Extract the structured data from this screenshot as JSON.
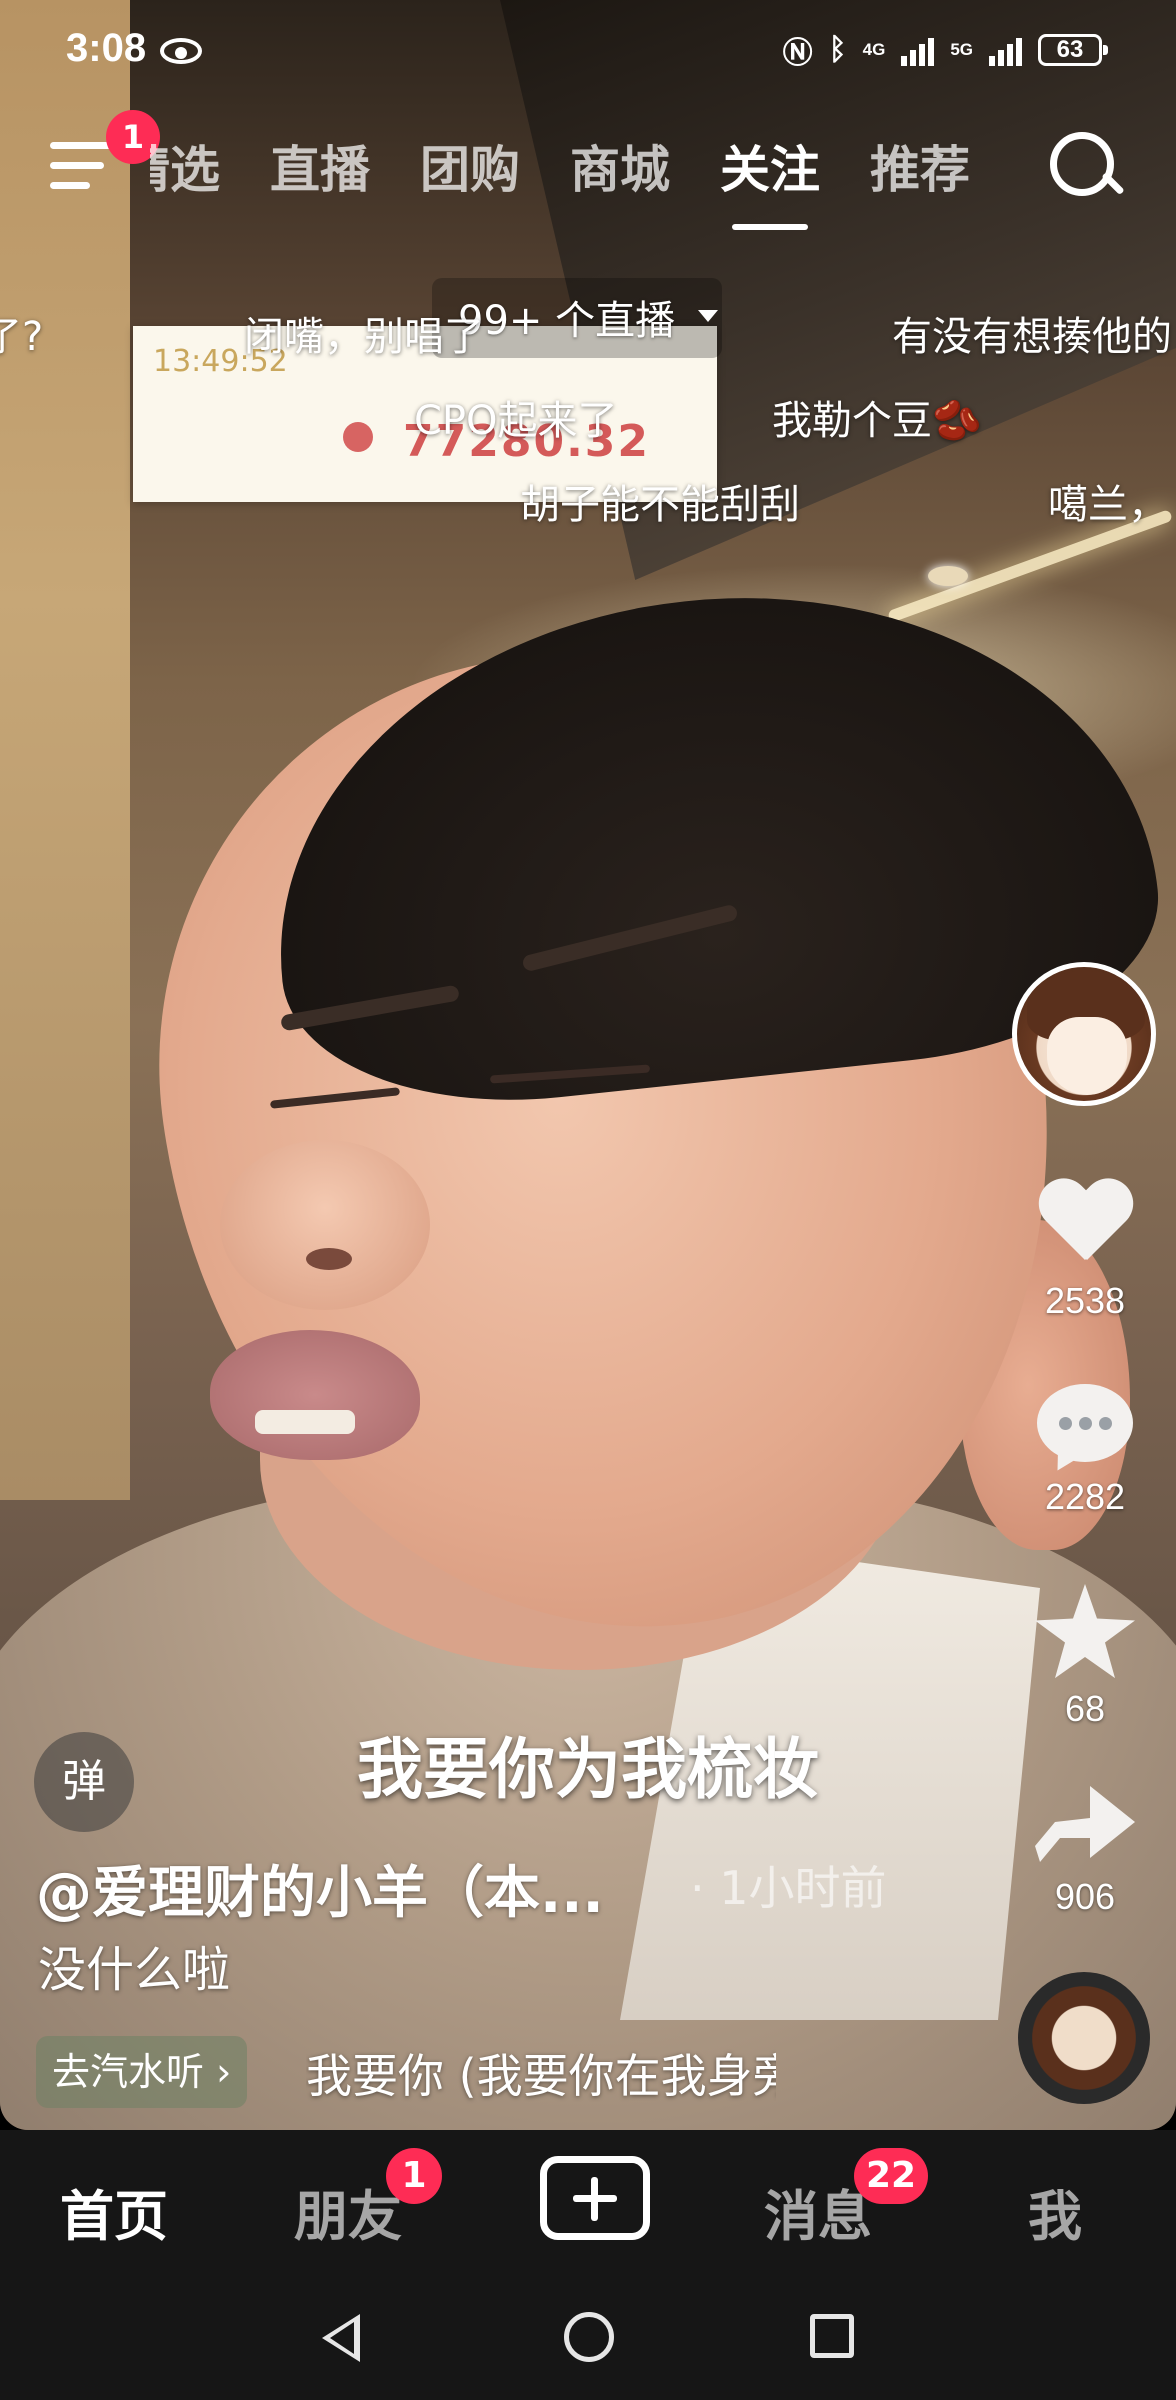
{
  "status_bar": {
    "time": "3:08",
    "net1": "4G",
    "net2": "5G",
    "battery": "63"
  },
  "top_nav": {
    "menu_badge": "1",
    "tabs": [
      "精选",
      "直播",
      "团购",
      "商城",
      "关注",
      "推荐"
    ],
    "active_tab": "关注",
    "live_label": "99+ 个直播"
  },
  "embedded_card": {
    "time": "13:49:52",
    "amount": "77280.32"
  },
  "danmaku": [
    "了?",
    "闭嘴，别唱了",
    "有没有想揍他的",
    "CPO起来了",
    "我勒个豆🫘",
    "胡子能不能刮刮",
    "噶兰，"
  ],
  "subtitle": "我要你为我梳妆",
  "post": {
    "danmu_toggle": "弹",
    "author": "@爱理财的小羊（本...",
    "posted": "· 1小时前",
    "description": "没什么啦",
    "music_chip": "去汽水听 ›",
    "music_title": "我要你 (我要你在我身旁"
  },
  "actions": {
    "likes": "2538",
    "comments": "2282",
    "favorites": "68",
    "shares": "906"
  },
  "bottom_nav": {
    "home": "首页",
    "friends": "朋友",
    "friends_badge": "1",
    "messages": "消息",
    "messages_badge": "22",
    "me": "我"
  },
  "colors": {
    "badge": "#fe2c55",
    "nav_bg": "#161616"
  }
}
